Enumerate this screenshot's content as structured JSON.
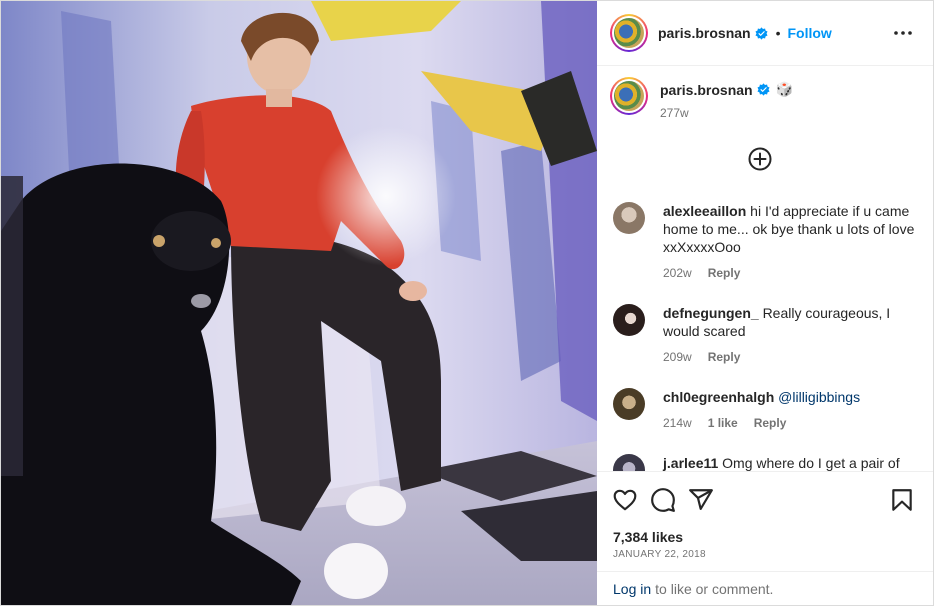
{
  "post": {
    "username": "paris.brosnan",
    "follow_label": "Follow",
    "separator": "•"
  },
  "caption": {
    "username": "paris.brosnan",
    "emoji": "🎲",
    "time": "277w"
  },
  "comments": [
    {
      "user": "alexleeaillon",
      "text": "hi I'd appreciate if u came home to me... ok bye thank u lots of love xxXxxxxOoo",
      "time": "202w",
      "likes": "",
      "reply": "Reply",
      "avatar_color": "#b8a89a"
    },
    {
      "user": "defnegungen_",
      "text": "Really courageous, I would scared",
      "time": "209w",
      "likes": "",
      "reply": "Reply",
      "avatar_color": "#3a2a28"
    },
    {
      "user": "chl0egreenhalgh",
      "text": "",
      "mention": "@lilligibbings",
      "time": "214w",
      "likes": "1 like",
      "reply": "Reply",
      "avatar_color": "#6a5a3a"
    },
    {
      "user": "j.arlee11",
      "text": "Omg where do I get a pair of",
      "time": "",
      "likes": "",
      "reply": "",
      "avatar_color": "#4a4a5a"
    }
  ],
  "stats": {
    "likes": "7,384 likes",
    "date": "JANUARY 22, 2018"
  },
  "login": {
    "link": "Log in",
    "rest": "to like or comment."
  },
  "icons": {
    "verified": "verified-badge-icon",
    "more": "more-options-icon",
    "add": "add-comment-circle-icon",
    "like": "heart-icon",
    "comment": "comment-bubble-icon",
    "share": "paper-plane-icon",
    "save": "bookmark-icon"
  },
  "colors": {
    "accent": "#0095f6",
    "verified": "#0095f6",
    "link": "#00376b",
    "muted": "#737373"
  }
}
